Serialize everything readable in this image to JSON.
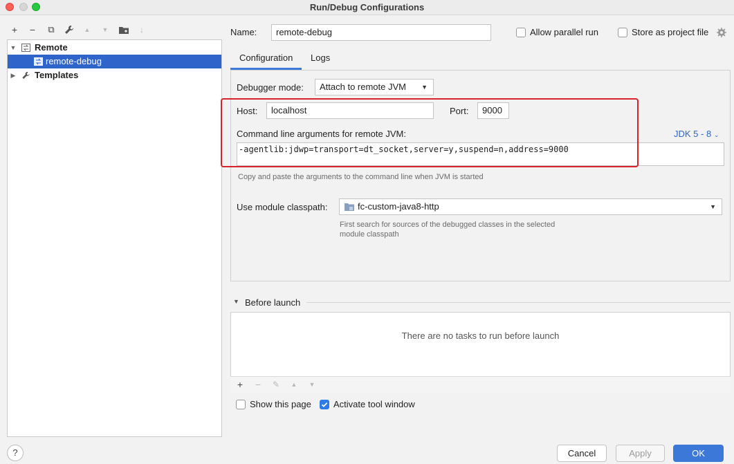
{
  "window": {
    "title": "Run/Debug Configurations"
  },
  "toolbar": {
    "add": "+",
    "remove": "−",
    "copy": "⧉",
    "settings": "🔧",
    "up": "▲",
    "down": "▼",
    "folder": "▦",
    "sort": "↓"
  },
  "tree": {
    "remote_label": "Remote",
    "child_label": "remote-debug",
    "templates_label": "Templates"
  },
  "header": {
    "name_label": "Name:",
    "name_value": "remote-debug",
    "allow_parallel_label": "Allow parallel run",
    "store_project_label": "Store as project file"
  },
  "tabs": [
    {
      "label": "Configuration"
    },
    {
      "label": "Logs"
    }
  ],
  "config": {
    "debugger_mode_label": "Debugger mode:",
    "debugger_mode_value": "Attach to remote JVM",
    "host_label": "Host:",
    "host_value": "localhost",
    "port_label": "Port:",
    "port_value": "9000",
    "cmd_label": "Command line arguments for remote JVM:",
    "jdk_label": "JDK 5 - 8",
    "cmd_value": "-agentlib:jdwp=transport=dt_socket,server=y,suspend=n,address=9000",
    "cmd_hint": "Copy and paste the arguments to the command line when JVM is started",
    "module_label": "Use module classpath:",
    "module_value": "fc-custom-java8-http",
    "module_hint_1": "First search for sources of the debugged classes in the selected",
    "module_hint_2": "module classpath"
  },
  "before_launch": {
    "title": "Before launch",
    "empty_text": "There are no tasks to run before launch",
    "add": "+",
    "remove": "−",
    "edit": "✎",
    "up": "▲",
    "down": "▼"
  },
  "options": {
    "show_page_label": "Show this page",
    "activate_tool_label": "Activate tool window"
  },
  "buttons": {
    "help": "?",
    "cancel": "Cancel",
    "apply": "Apply",
    "ok": "OK"
  }
}
